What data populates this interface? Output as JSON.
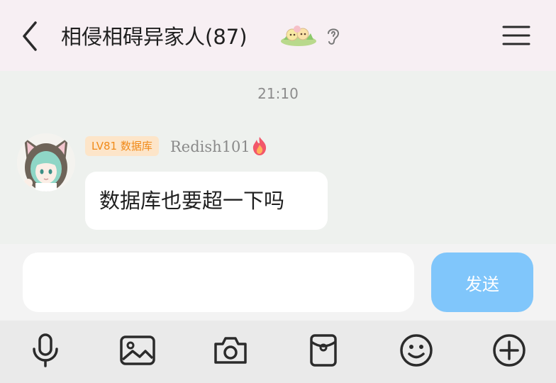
{
  "header": {
    "title": "相侵相碍异家人(87)",
    "icons": [
      "back-arrow-icon",
      "flower-sticker-icon",
      "ear-icon",
      "menu-icon"
    ]
  },
  "chat": {
    "timestamp": "21:10",
    "messages": [
      {
        "level_badge": "LV81 数据库",
        "nickname": "Redish101",
        "text": "数据库也要超一下吗",
        "icons": [
          "avatar",
          "flame-icon"
        ]
      }
    ]
  },
  "composer": {
    "input_value": "",
    "send_label": "发送"
  },
  "toolbar": {
    "icons": [
      "microphone-icon",
      "image-icon",
      "camera-icon",
      "red-packet-icon",
      "emoji-icon",
      "plus-icon"
    ]
  },
  "colors": {
    "header_bg": "#f7eff3",
    "chat_bg": "#eef1ee",
    "badge_text": "#f08a19",
    "badge_bg": "#fde5c9",
    "send_bg": "#80c6fb"
  }
}
